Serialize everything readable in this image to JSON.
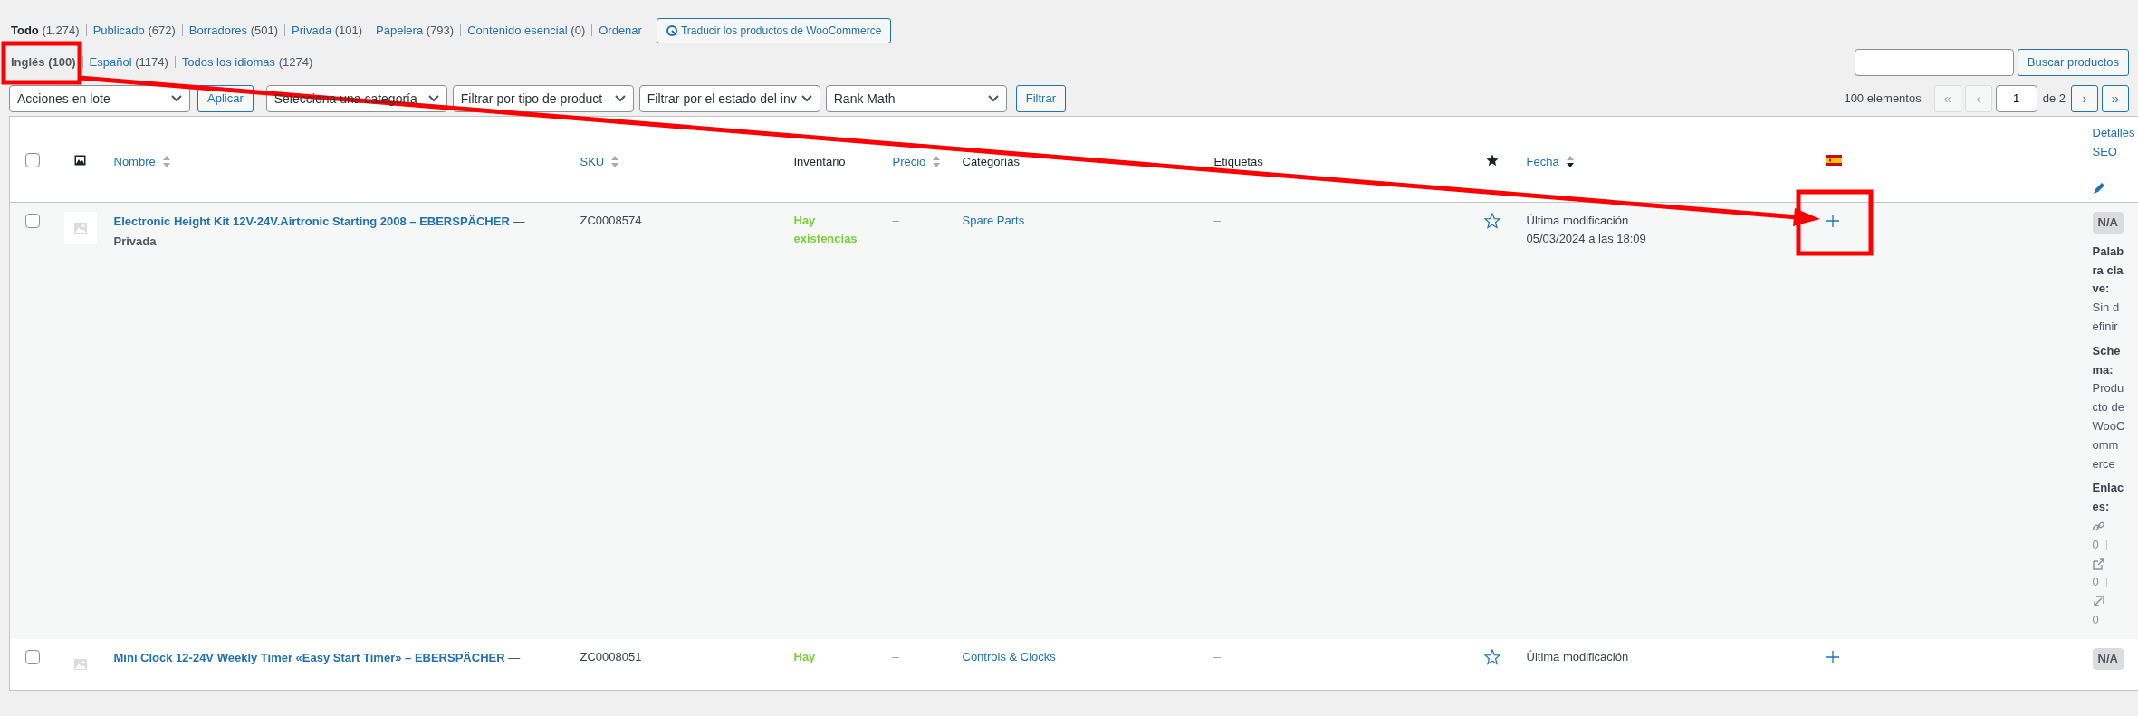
{
  "status_links": [
    {
      "label": "Todo",
      "count": "(1.274)",
      "selected": true
    },
    {
      "label": "Publicado",
      "count": "(672)",
      "selected": false
    },
    {
      "label": "Borradores",
      "count": "(501)",
      "selected": false
    },
    {
      "label": "Privada",
      "count": "(101)",
      "selected": false
    },
    {
      "label": "Papelera",
      "count": "(793)",
      "selected": false
    },
    {
      "label": "Contenido esencial",
      "count": "(0)",
      "selected": false
    },
    {
      "label": "Ordenar",
      "selected": false
    }
  ],
  "translate_button": "Traducir los productos de WooCommerce",
  "language_links": [
    {
      "label": "Inglés",
      "count": "(100)",
      "selected": true
    },
    {
      "label": "Español",
      "count": "(1174)",
      "selected": false
    },
    {
      "label": "Todos los idiomas",
      "count": "(1274)",
      "selected": false
    }
  ],
  "search": {
    "button": "Buscar productos"
  },
  "filters": {
    "bulk_action": "Acciones en lote",
    "apply": "Aplicar",
    "selects": [
      "Selecciona una categoría",
      "Filtrar por tipo de product",
      "Filtrar por el estado del inv",
      "Rank Math"
    ],
    "filter_button": "Filtrar"
  },
  "pagination": {
    "count": "100 elementos",
    "buttons": [
      {
        "label": "«",
        "disabled": true
      },
      {
        "label": "‹",
        "disabled": true
      }
    ],
    "page": "1",
    "of": "de 2",
    "next_buttons": [
      {
        "label": "›",
        "disabled": false
      },
      {
        "label": "»",
        "disabled": false
      }
    ]
  },
  "columns": [
    {
      "kind": "checkbox",
      "checked": false
    },
    {
      "kind": "image"
    },
    {
      "kind": "text",
      "label": "Nombre",
      "sortable": true
    },
    {
      "kind": "text",
      "label": "SKU",
      "sortable": true
    },
    {
      "kind": "text",
      "label": "Inventario",
      "sortable": false
    },
    {
      "kind": "text",
      "label": "Precio",
      "sortable": true
    },
    {
      "kind": "text",
      "label": "Categorías",
      "sortable": false
    },
    {
      "kind": "text",
      "label": "Etiquetas",
      "sortable": false
    },
    {
      "kind": "star"
    },
    {
      "kind": "text",
      "label": "Fecha",
      "sortable": true,
      "sorted": true
    },
    {
      "kind": "flag"
    },
    {
      "kind": "seo",
      "label": "Detalles SEO"
    }
  ],
  "rows": [
    {
      "checked": false,
      "name": "Electronic Height Kit 12V-24V.Airtronic Starting 2008 – EBERSPÄCHER",
      "name_suffix": "—",
      "status": "Privada",
      "sku": "ZC0008574",
      "stock": "Hay existencias",
      "price": "–",
      "category": "Spare Parts",
      "tags": "–",
      "featured": false,
      "date_label": "Última modificación",
      "date": "05/03/2024 a las 18:09",
      "seo": {
        "score": "N/A",
        "keyword_label": "Palabra clave:",
        "keyword": "Sin definir",
        "schema_label": "Schema:",
        "schema": "Producto de WooCommerce",
        "links_label": "Enlaces:",
        "internal": "0",
        "external": "0",
        "incoming": "0"
      }
    },
    {
      "checked": false,
      "name": "Mini Clock 12-24V Weekly Timer «Easy Start Timer» – EBERSPÄCHER",
      "name_suffix": "—",
      "sku": "ZC0008051",
      "stock": "Hay",
      "price": "–",
      "category": "Controls & Clocks",
      "tags": "–",
      "featured": false,
      "date_label": "Última modificación",
      "seo": {
        "score": "N/A"
      }
    }
  ]
}
